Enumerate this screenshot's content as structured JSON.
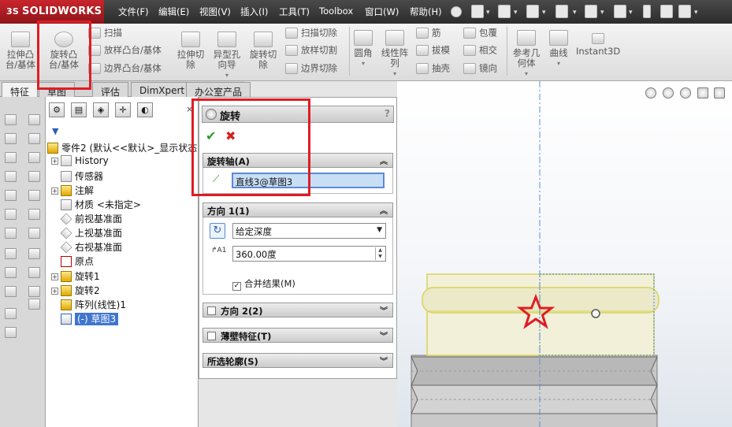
{
  "app": {
    "logo_text": "SOLIDWORKS",
    "logo_mark": "3S"
  },
  "menu": [
    "文件(F)",
    "编辑(E)",
    "视图(V)",
    "插入(I)",
    "工具(T)",
    "Toolbox",
    "窗口(W)",
    "帮助(H)"
  ],
  "toolbar": {
    "extrude_boss": "拉伸凸台/基体",
    "revolve_boss": "旋转凸台/基体",
    "sweep": "扫描",
    "loft_boss": "放样凸台/基体",
    "boundary_boss": "边界凸台/基体",
    "extrude_cut": "拉伸切除",
    "hole_wizard": "异型孔向导",
    "revolve_cut": "旋转切除",
    "swept_cut": "扫描切除",
    "lofted_cut": "放样切割",
    "boundary_cut": "边界切除",
    "fillet": "圆角",
    "linear_pattern": "线性阵列",
    "rib": "筋",
    "draft": "拔模",
    "shell": "抽壳",
    "wrap": "包覆",
    "intersect": "相交",
    "mirror": "镜向",
    "ref_geometry": "参考几何体",
    "curves": "曲线",
    "instant3d": "Instant3D"
  },
  "tabs": [
    "特征",
    "草图",
    "评估",
    "DimXpert",
    "办公室产品"
  ],
  "active_tab": 0,
  "tree": {
    "root": "零件2  (默认<<默认>_显示状态",
    "items": [
      {
        "label": "History",
        "expandable": true
      },
      {
        "label": "传感器",
        "expandable": false
      },
      {
        "label": "注解",
        "expandable": true
      },
      {
        "label": "材质 <未指定>",
        "expandable": false
      },
      {
        "label": "前视基准面",
        "expandable": false
      },
      {
        "label": "上视基准面",
        "expandable": false
      },
      {
        "label": "右视基准面",
        "expandable": false
      },
      {
        "label": "原点",
        "expandable": false
      },
      {
        "label": "旋转1",
        "expandable": true
      },
      {
        "label": "旋转2",
        "expandable": true
      },
      {
        "label": "阵列(线性)1",
        "expandable": false
      },
      {
        "label": "(-) 草图3",
        "expandable": false,
        "selected": true
      }
    ]
  },
  "property_manager": {
    "title": "旋转",
    "help": "?",
    "ok": "✔",
    "cancel": "✖",
    "axis_group": {
      "title": "旋转轴(A)",
      "value": "直线3@草图3"
    },
    "direction1": {
      "title": "方向 1(1)",
      "type": "给定深度",
      "angle": "360.00度",
      "merge_label": "合并结果(M)",
      "merge_checked": true
    },
    "direction2": {
      "title": "方向 2(2)"
    },
    "thin_feature": {
      "title": "薄壁特征(T)"
    },
    "contours": {
      "title": "所选轮廓(S)"
    }
  },
  "colors": {
    "annotation": "#e01c24",
    "selection": "#3f75cf",
    "logo": "#c9252c"
  },
  "icons": {
    "menubar": [
      "pin-icon",
      "new-icon",
      "open-icon",
      "save-icon",
      "print-icon",
      "undo-icon",
      "select-icon",
      "rebuild-icon",
      "options-icon"
    ],
    "view_hud": [
      "zoom-to-fit-icon",
      "zoom-area-icon",
      "previous-view-icon",
      "section-view-icon",
      "view-orientation-icon"
    ]
  }
}
